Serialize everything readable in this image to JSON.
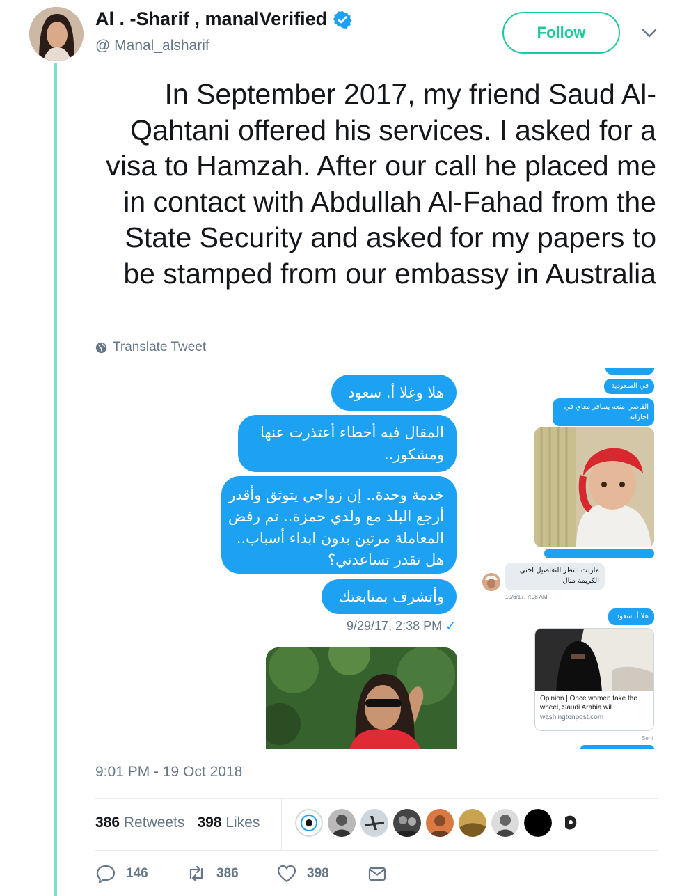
{
  "user": {
    "display_name": "Al . -Sharif , manalVerified",
    "handle": "@ Manal_alsharif",
    "follow_label": "Follow"
  },
  "tweet": {
    "text": "In September 2017, my friend Saud Al-Qahtani offered his services. I asked for a visa to Hamzah. After our call he placed me in contact with Abdullah Al-Fahad from the State Security and asked for my papers to be stamped from our embassy in Australia",
    "translate_label": "Translate Tweet",
    "timestamp": "9:01 PM - 19 Oct 2018"
  },
  "media": {
    "left_messages": [
      "هلا وغلا أ. سعود",
      "المقال فيه أخطاء أعتذرت عنها ومشكور..",
      "خدمة وحدة.. إن زواجي يتوثق وأقدر أرجع البلد مع ولدي حمزة.. تم رفض المعاملة مرتين بدون ابداء أسباب.. هل تقدر تساعدني؟",
      "وأتشرف بمتابعتك"
    ],
    "left_time": "9/29/17, 2:38 PM",
    "right_messages": {
      "m1": "في السعودية",
      "m2": "القاضي منعه يسافر معاي في اجازاته..",
      "reply": "مازلت انتظر التفاصيل اختي الكريمة منال",
      "reply_time": "10/6/17, 7:08 AM",
      "m3": "هلا أ. سعود"
    },
    "link_card": {
      "title": "Opinion | Once women take the wheel, Saudi Arabia wil...",
      "domain": "washingtonpost.com"
    },
    "sent_label": "Sent"
  },
  "stats": {
    "retweets_count": "386",
    "retweets_label": "Retweets",
    "likes_count": "398",
    "likes_label": "Likes"
  },
  "actions": {
    "replies": "146",
    "retweets": "386",
    "likes": "398"
  },
  "colors": {
    "accent": "#1dcaa0",
    "bubble": "#1da1f2",
    "thread_line": "#7ee0c5",
    "muted": "#657786"
  }
}
